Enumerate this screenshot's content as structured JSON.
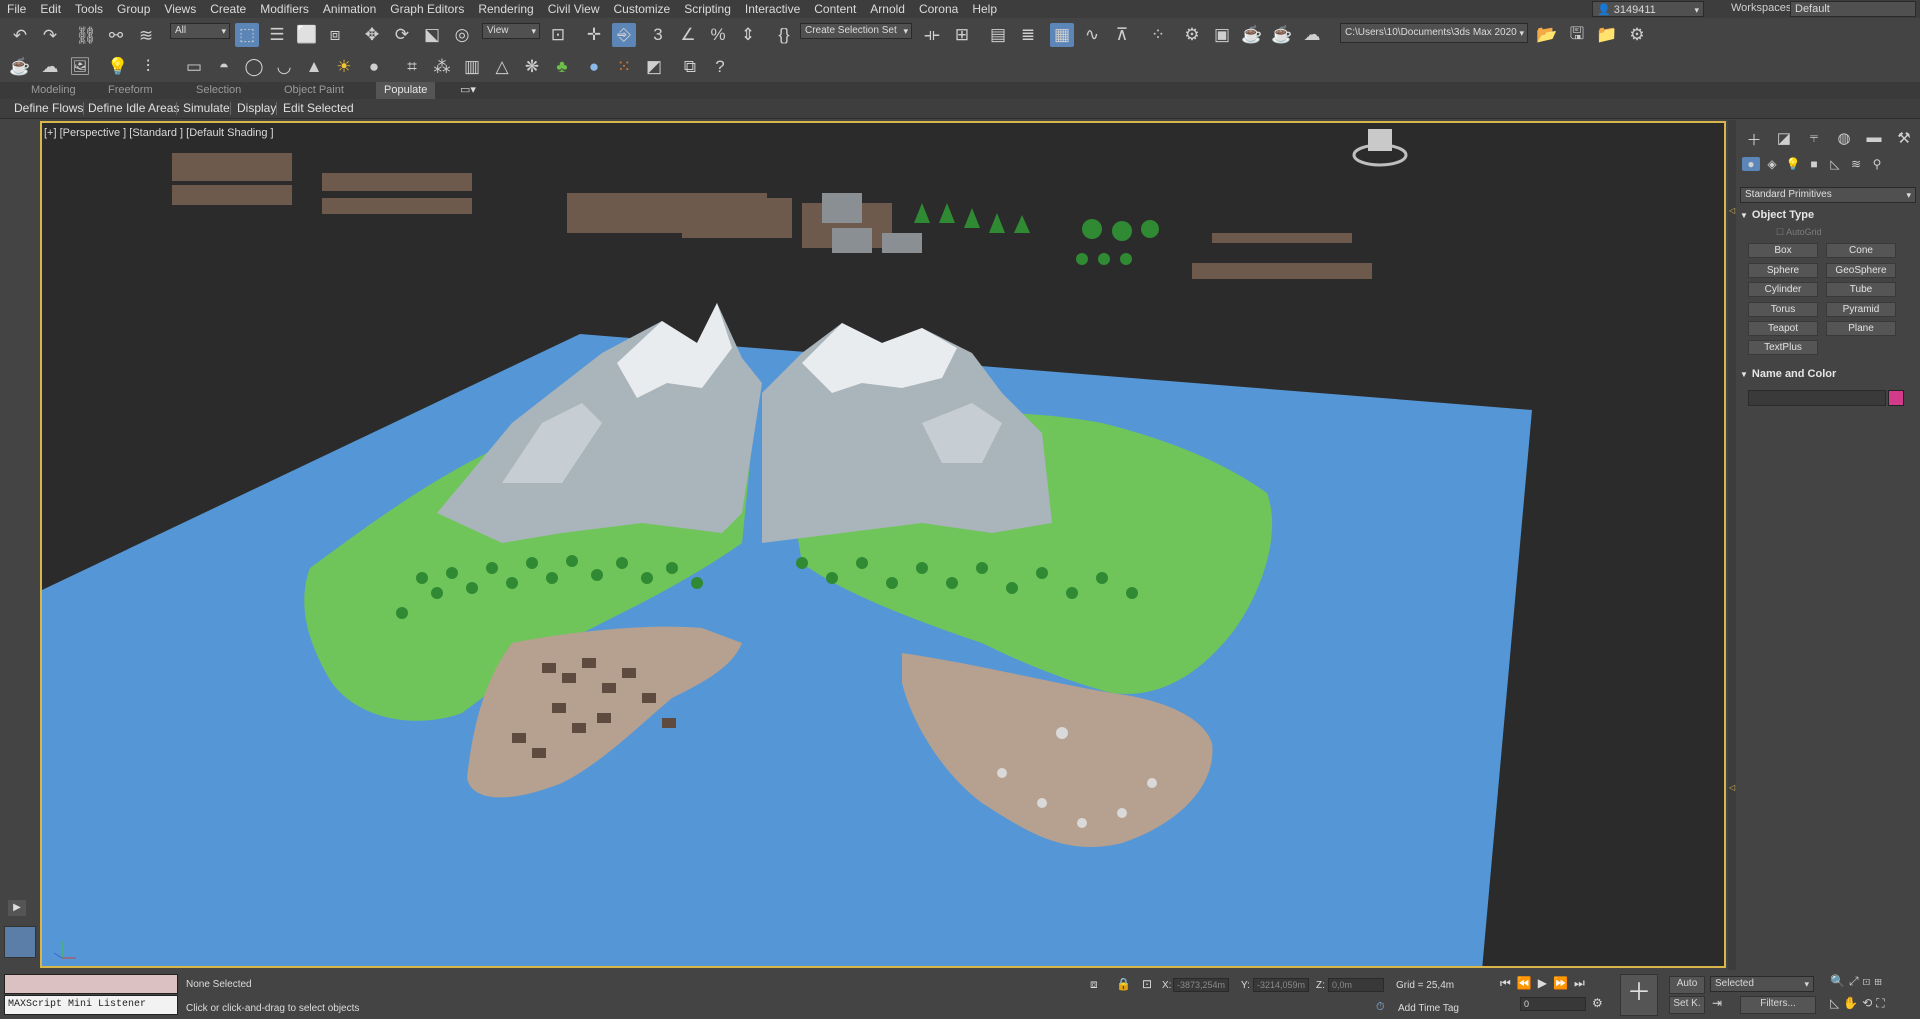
{
  "menu": [
    "File",
    "Edit",
    "Tools",
    "Group",
    "Views",
    "Create",
    "Modifiers",
    "Animation",
    "Graph Editors",
    "Rendering",
    "Civil View",
    "Customize",
    "Scripting",
    "Interactive",
    "Content",
    "Arnold",
    "Corona",
    "Help"
  ],
  "user": {
    "name": "3149411"
  },
  "workspace": {
    "label": "Workspaces:",
    "value": "Default"
  },
  "toolbar": {
    "selection_filter": "All",
    "ref_coord": "View",
    "named_selection": "Create Selection Set",
    "project_path": "C:\\Users\\10\\Documents\\3ds Max 2020"
  },
  "ribbon": {
    "tabs": [
      "Modeling",
      "Freeform",
      "Selection",
      "Object Paint",
      "Populate"
    ],
    "active_tab": "Populate",
    "buttons": [
      "Define Flows",
      "Define Idle Areas",
      "Simulate",
      "Display",
      "Edit Selected"
    ]
  },
  "viewport": {
    "label": "[+] [Perspective ] [Standard ] [Default Shading ]"
  },
  "command_panel": {
    "category": "Standard Primitives",
    "object_type_title": "Object Type",
    "autogrid": "AutoGrid",
    "buttons": [
      "Box",
      "Cone",
      "Sphere",
      "GeoSphere",
      "Cylinder",
      "Tube",
      "Torus",
      "Pyramid",
      "Teapot",
      "Plane",
      "TextPlus"
    ],
    "name_color_title": "Name and Color",
    "object_color": "#d23a8a"
  },
  "status": {
    "maxscript_label": "MAXScript Mini Listener",
    "selection": "None Selected",
    "prompt": "Click or click-and-drag to select objects",
    "x_label": "X:",
    "x_value": "-3873,254m",
    "y_label": "Y:",
    "y_value": "-3214,059m",
    "z_label": "Z:",
    "z_value": "0,0m",
    "grid": "Grid = 25,4m",
    "add_time_tag": "Add Time Tag",
    "auto_key": "Auto",
    "set_key": "Set K.",
    "key_filter": "Selected",
    "filters": "Filters...",
    "frame": "0"
  },
  "colors": {
    "water": "#5597d6",
    "grass": "#6fc55a",
    "sand": "#b6a08f",
    "snow": "#e9ecef",
    "rock": "#aab4bb",
    "viewport_border": "#d9b64a"
  }
}
